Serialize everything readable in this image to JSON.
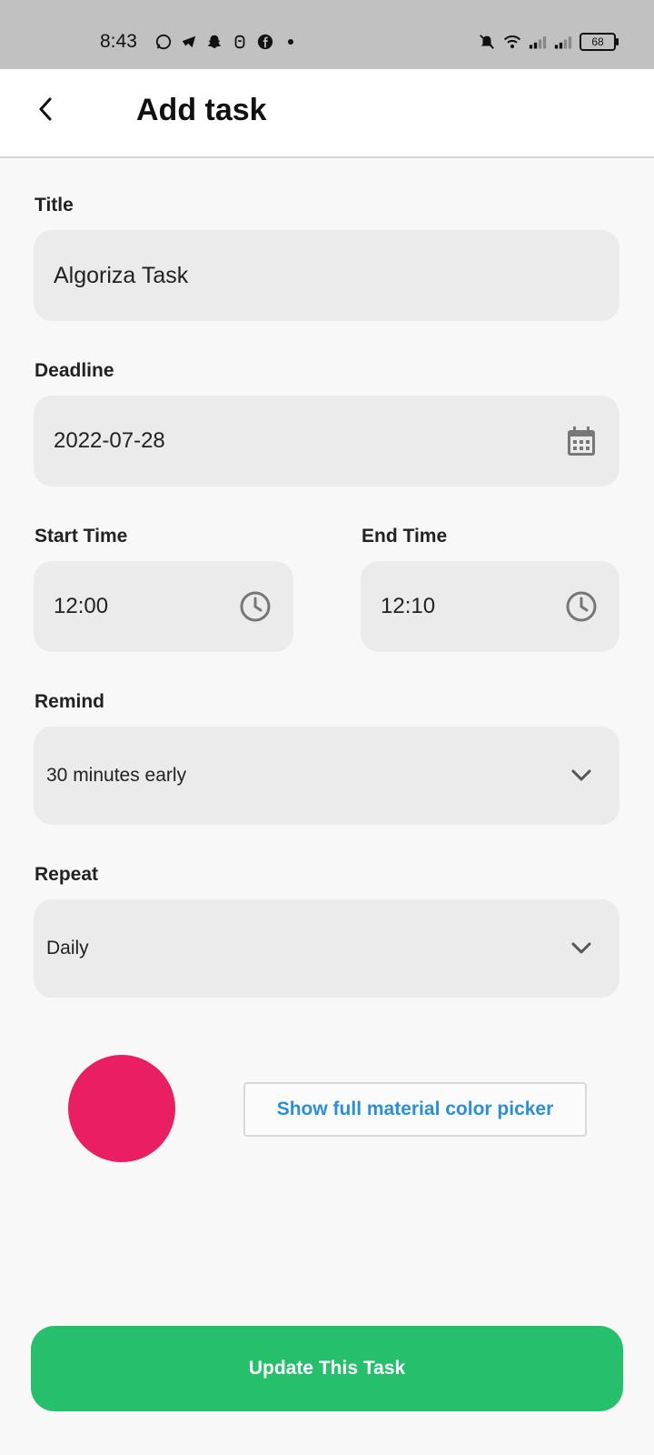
{
  "status_bar": {
    "time": "8:43",
    "left_icons": [
      "whatsapp-icon",
      "telegram-icon",
      "snapchat-icon",
      "notification-icon",
      "facebook-icon",
      "dot-icon"
    ],
    "right_icons": [
      "mute-icon",
      "wifi-icon",
      "signal-icon",
      "signal-icon"
    ],
    "battery": "68"
  },
  "header": {
    "title": "Add task",
    "back_icon": "chevron-left-icon"
  },
  "form": {
    "title_label": "Title",
    "title_value": "Algoriza Task",
    "deadline_label": "Deadline",
    "deadline_value": "2022-07-28",
    "deadline_icon": "calendar-icon",
    "start_label": "Start Time",
    "start_value": "12:00",
    "end_label": "End Time",
    "end_value": "12:10",
    "time_icon": "clock-icon",
    "remind_label": "Remind",
    "remind_value": "30 minutes early",
    "repeat_label": "Repeat",
    "repeat_value": "Daily",
    "dropdown_icon": "chevron-down-icon"
  },
  "color": {
    "selected": "#e91e63",
    "picker_label": "Show full material color picker"
  },
  "actions": {
    "update_label": "Update This Task",
    "update_color": "#26c06c"
  }
}
